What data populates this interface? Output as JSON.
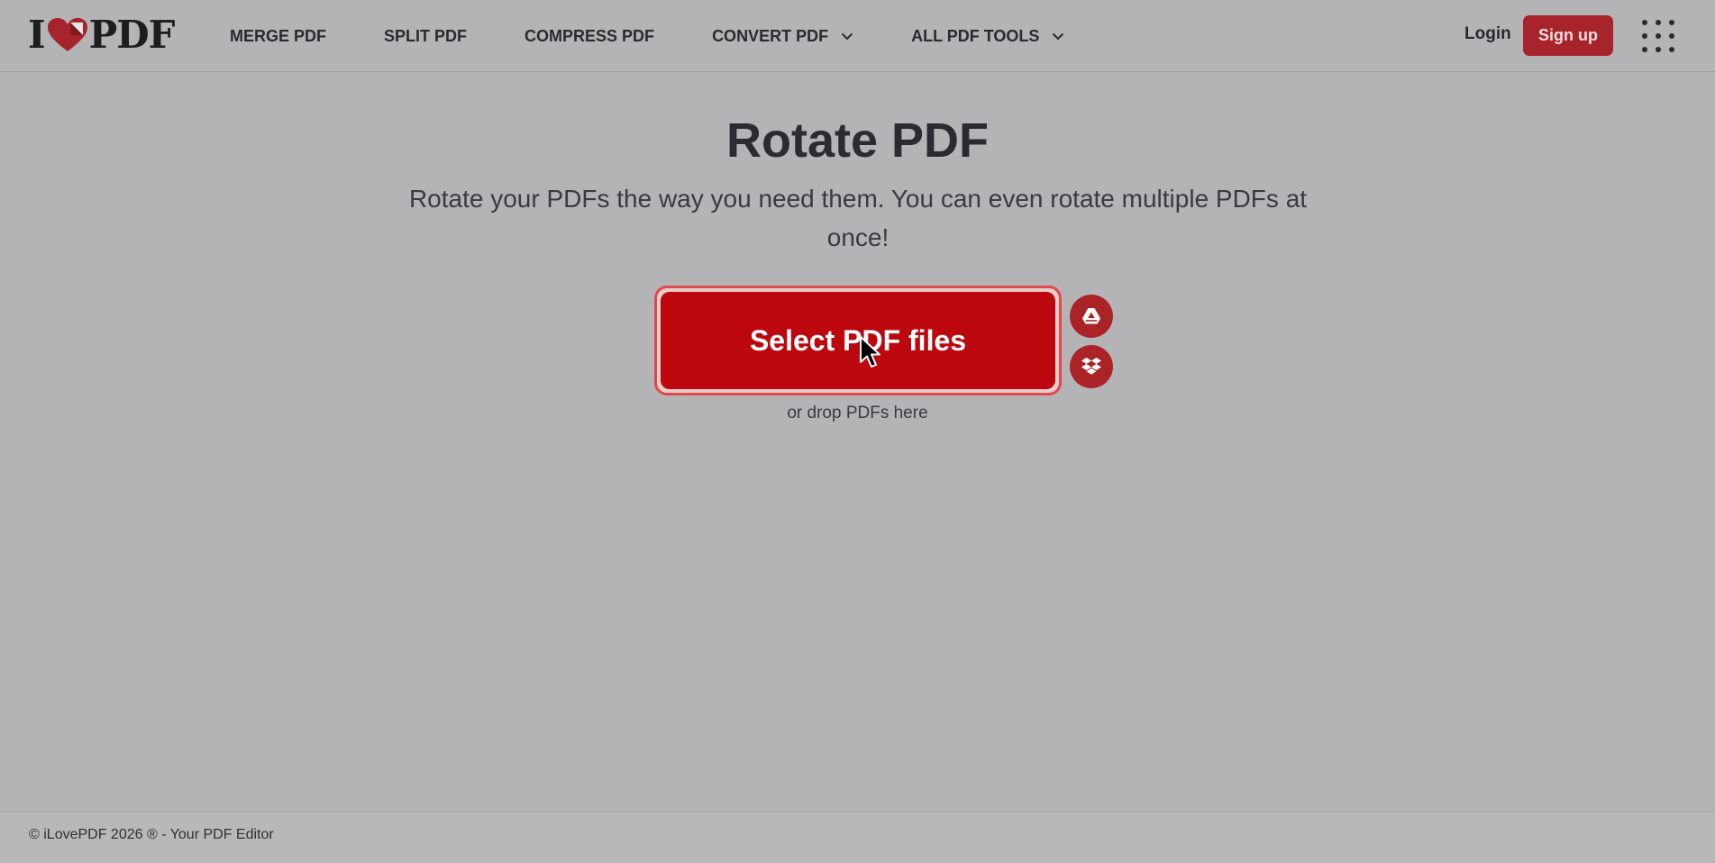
{
  "header": {
    "logo": {
      "left": "I",
      "right": "PDF"
    },
    "nav": [
      {
        "label": "MERGE PDF",
        "has_dropdown": false
      },
      {
        "label": "SPLIT PDF",
        "has_dropdown": false
      },
      {
        "label": "COMPRESS PDF",
        "has_dropdown": false
      },
      {
        "label": "CONVERT PDF",
        "has_dropdown": true
      },
      {
        "label": "ALL PDF TOOLS",
        "has_dropdown": true
      }
    ],
    "login_label": "Login",
    "signup_label": "Sign up",
    "apps_icon": "grid-icon"
  },
  "main": {
    "title": "Rotate PDF",
    "subtitle": "Rotate your PDFs the way you need them. You can even rotate multiple PDFs at once!",
    "select_button_label": "Select PDF files",
    "drop_hint": "or drop PDFs here",
    "cloud_sources": [
      {
        "icon": "google-drive-icon"
      },
      {
        "icon": "dropbox-icon"
      }
    ]
  },
  "footer": {
    "text": "© iLovePDF 2026 ® - Your PDF Editor"
  },
  "colors": {
    "background": "#b4b4b6",
    "brand_red": "#bd070e",
    "signup_red": "#a8242c",
    "focus_ring": "#e2494c",
    "text_dark": "#2b2b30"
  }
}
